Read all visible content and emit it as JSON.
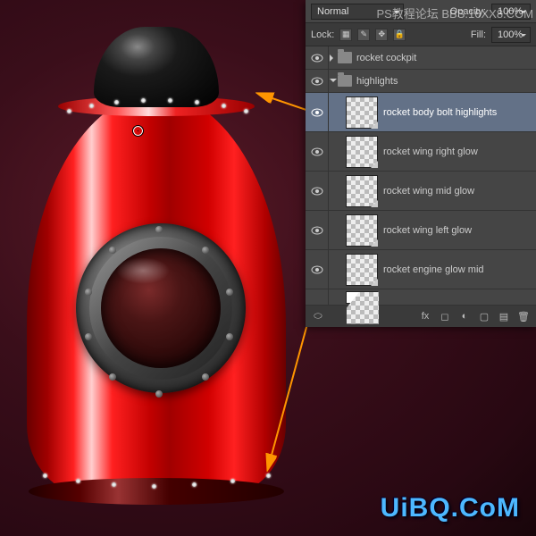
{
  "watermarks": {
    "top": "PS教程论坛  BBS.16XX8.COM",
    "logo": "UiBQ.CoM"
  },
  "panel": {
    "blendMode": "Normal",
    "opacityLabel": "Opacity:",
    "opacityValue": "100%",
    "lockLabel": "Lock:",
    "fillLabel": "Fill:",
    "fillValue": "100%"
  },
  "layers": [
    {
      "type": "group",
      "name": "rocket cockpit",
      "depth": 0,
      "open": false,
      "visible": true
    },
    {
      "type": "group",
      "name": "highlights",
      "depth": 0,
      "open": true,
      "visible": true
    },
    {
      "type": "layer",
      "name": "rocket body bolt highlights",
      "depth": 1,
      "visible": true,
      "selected": true
    },
    {
      "type": "layer",
      "name": "rocket wing right glow",
      "depth": 1,
      "visible": true
    },
    {
      "type": "layer",
      "name": "rocket wing mid glow",
      "depth": 1,
      "visible": true
    },
    {
      "type": "layer",
      "name": "rocket wing left glow",
      "depth": 1,
      "visible": true
    },
    {
      "type": "layer",
      "name": "rocket engine glow mid",
      "depth": 1,
      "visible": true
    }
  ],
  "footer": {
    "link": "⧓",
    "fx": "fx",
    "mask": "◯",
    "adjust": "◐",
    "group": "▭",
    "new": "▦",
    "trash": "🗑"
  }
}
